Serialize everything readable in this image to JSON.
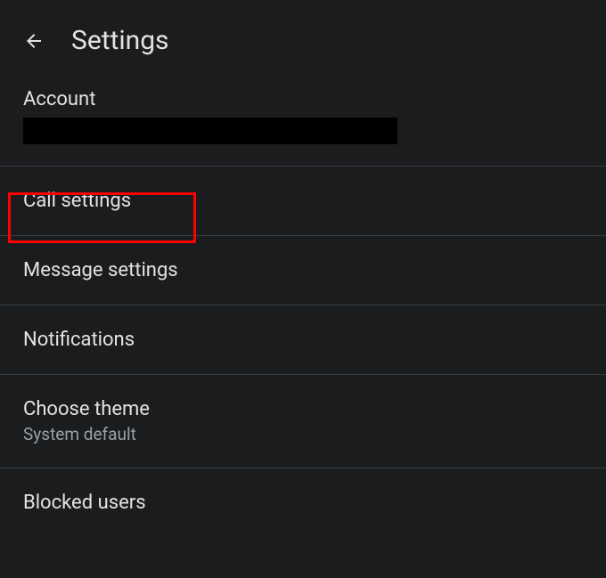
{
  "header": {
    "title": "Settings"
  },
  "account": {
    "label": "Account",
    "value": ""
  },
  "menu": {
    "call_settings": "Call settings",
    "message_settings": "Message settings",
    "notifications": "Notifications",
    "choose_theme": {
      "label": "Choose theme",
      "sublabel": "System default"
    },
    "blocked_users": "Blocked users"
  }
}
